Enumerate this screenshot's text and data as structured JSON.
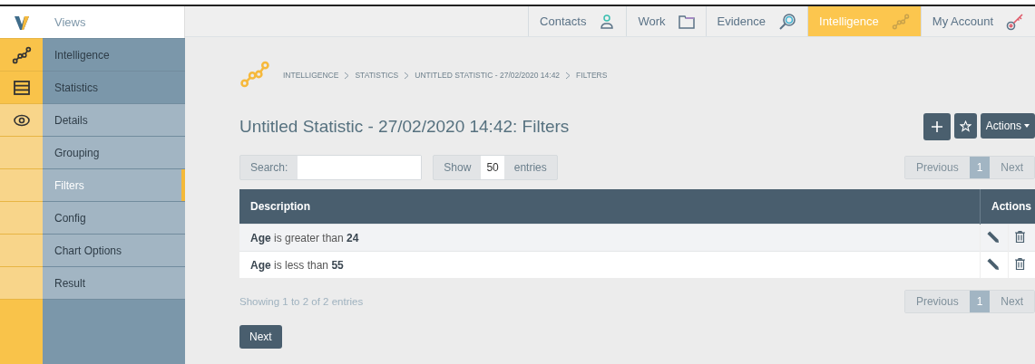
{
  "sidebar": {
    "header": "Views",
    "items": [
      {
        "label": "Intelligence",
        "kind": "section",
        "selected": false
      },
      {
        "label": "Statistics",
        "kind": "section",
        "selected": false
      },
      {
        "label": "Details",
        "kind": "page",
        "selected": false
      },
      {
        "label": "Grouping",
        "kind": "page",
        "selected": false
      },
      {
        "label": "Filters",
        "kind": "page",
        "selected": true
      },
      {
        "label": "Config",
        "kind": "page",
        "selected": false
      },
      {
        "label": "Chart Options",
        "kind": "page",
        "selected": false
      },
      {
        "label": "Result",
        "kind": "page",
        "selected": false
      }
    ]
  },
  "top_nav": [
    {
      "label": "Contacts",
      "selected": false
    },
    {
      "label": "Work",
      "selected": false
    },
    {
      "label": "Evidence",
      "selected": false
    },
    {
      "label": "Intelligence",
      "selected": true
    },
    {
      "label": "My Account",
      "selected": false
    }
  ],
  "breadcrumb": [
    "INTELLIGENCE",
    "STATISTICS",
    "UNTITLED STATISTIC - 27/02/2020 14:42",
    "FILTERS"
  ],
  "title": "Untitled Statistic - 27/02/2020 14:42: Filters",
  "actions_button": "Actions",
  "search": {
    "label": "Search:"
  },
  "page_length": {
    "prefix": "Show",
    "value": "50",
    "suffix": "entries"
  },
  "pagination": [
    {
      "label": "Previous",
      "selected": false
    },
    {
      "label": "1",
      "selected": true
    },
    {
      "label": "Next",
      "selected": false
    }
  ],
  "table": {
    "columns": [
      "Description",
      "Actions"
    ],
    "rows": [
      {
        "description": "**Age** is greater than **24**"
      },
      {
        "description": "**Age** is less than **55**"
      }
    ]
  },
  "info": "Showing 1 to 2 of 2 entries",
  "pagination_bottom": [
    {
      "label": "Previous",
      "selected": false
    },
    {
      "label": "1",
      "selected": true
    },
    {
      "label": "Next",
      "selected": false
    }
  ],
  "next_button": "Next"
}
